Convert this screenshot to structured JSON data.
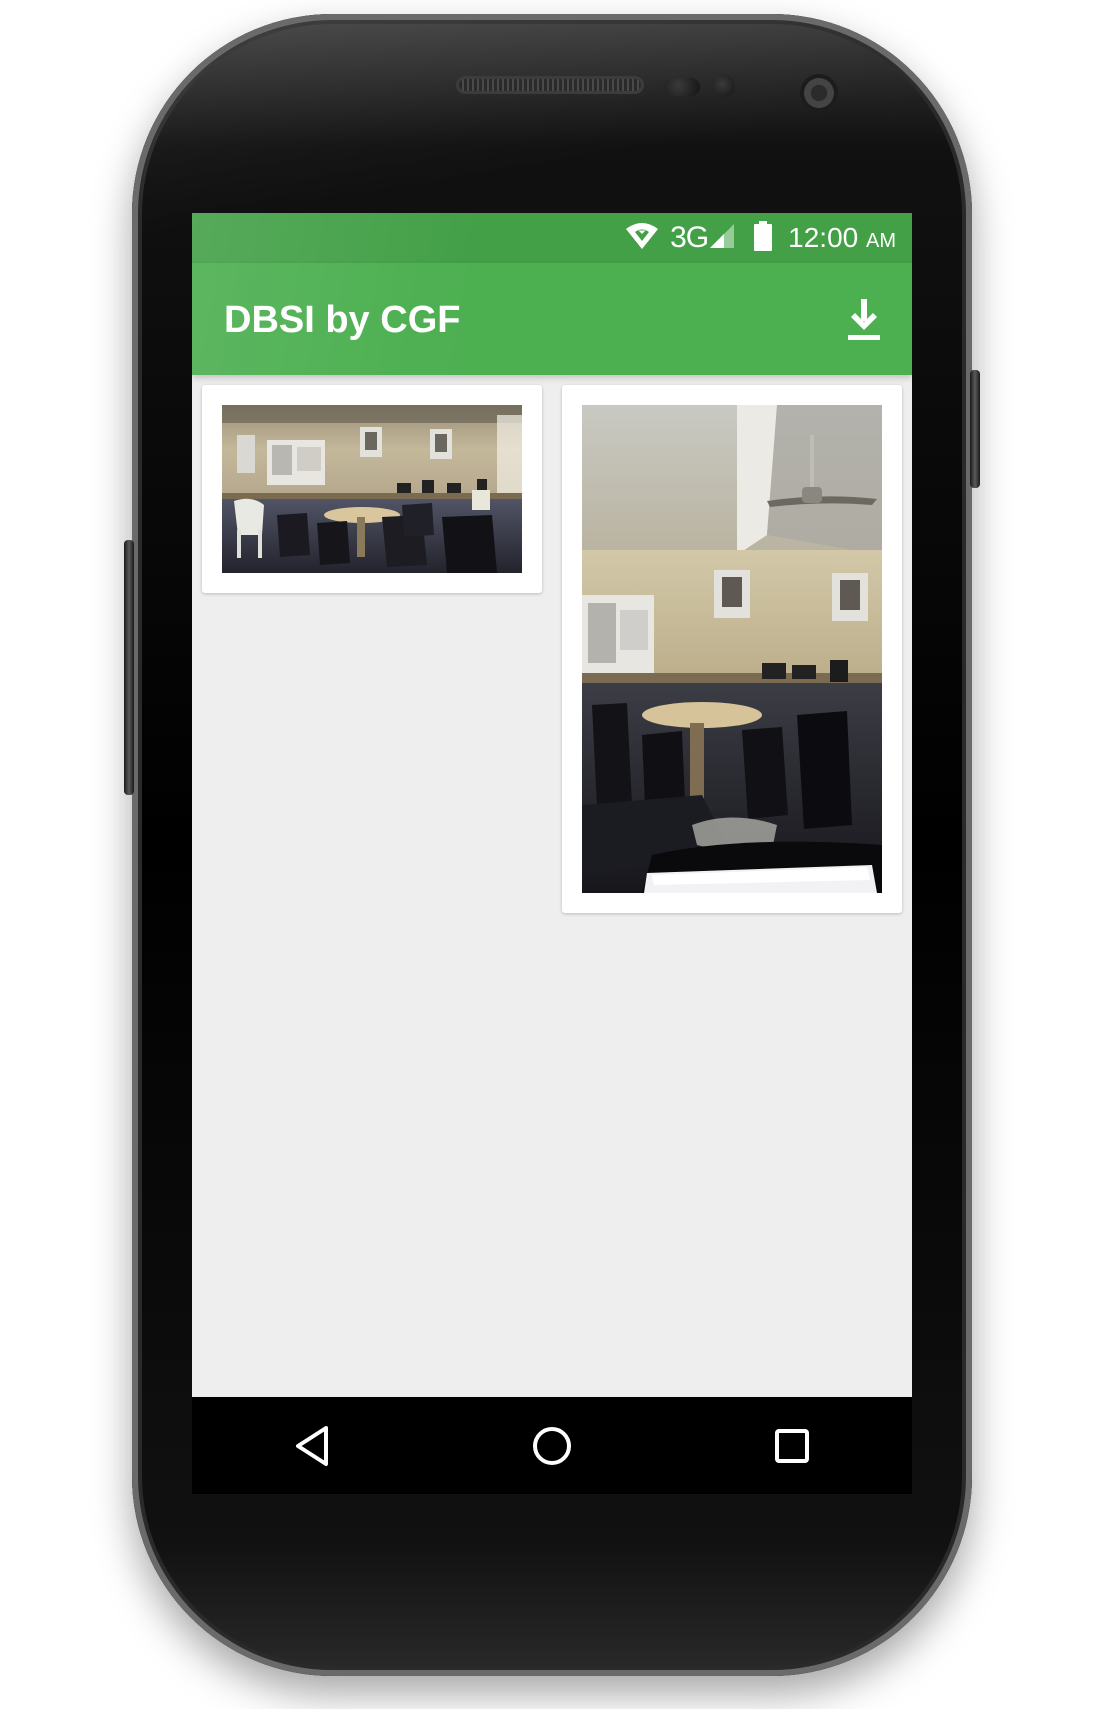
{
  "status_bar": {
    "network": "3G",
    "time": "12:00",
    "ampm": "AM",
    "icons": [
      "wifi-icon",
      "cell-signal-icon",
      "battery-icon"
    ]
  },
  "app_bar": {
    "title": "DBSI by CGF",
    "action_icon": "download-icon"
  },
  "gallery": {
    "items": [
      {
        "description_icon": "photo-classroom-wide"
      },
      {
        "description_icon": "photo-classroom-tall"
      }
    ]
  },
  "nav_bar": {
    "icons": [
      "back-icon",
      "home-icon",
      "recents-icon"
    ]
  },
  "colors": {
    "status_bar": "#43a047",
    "app_bar": "#4caf50",
    "background": "#eeeeee",
    "nav_bar": "#000000"
  }
}
